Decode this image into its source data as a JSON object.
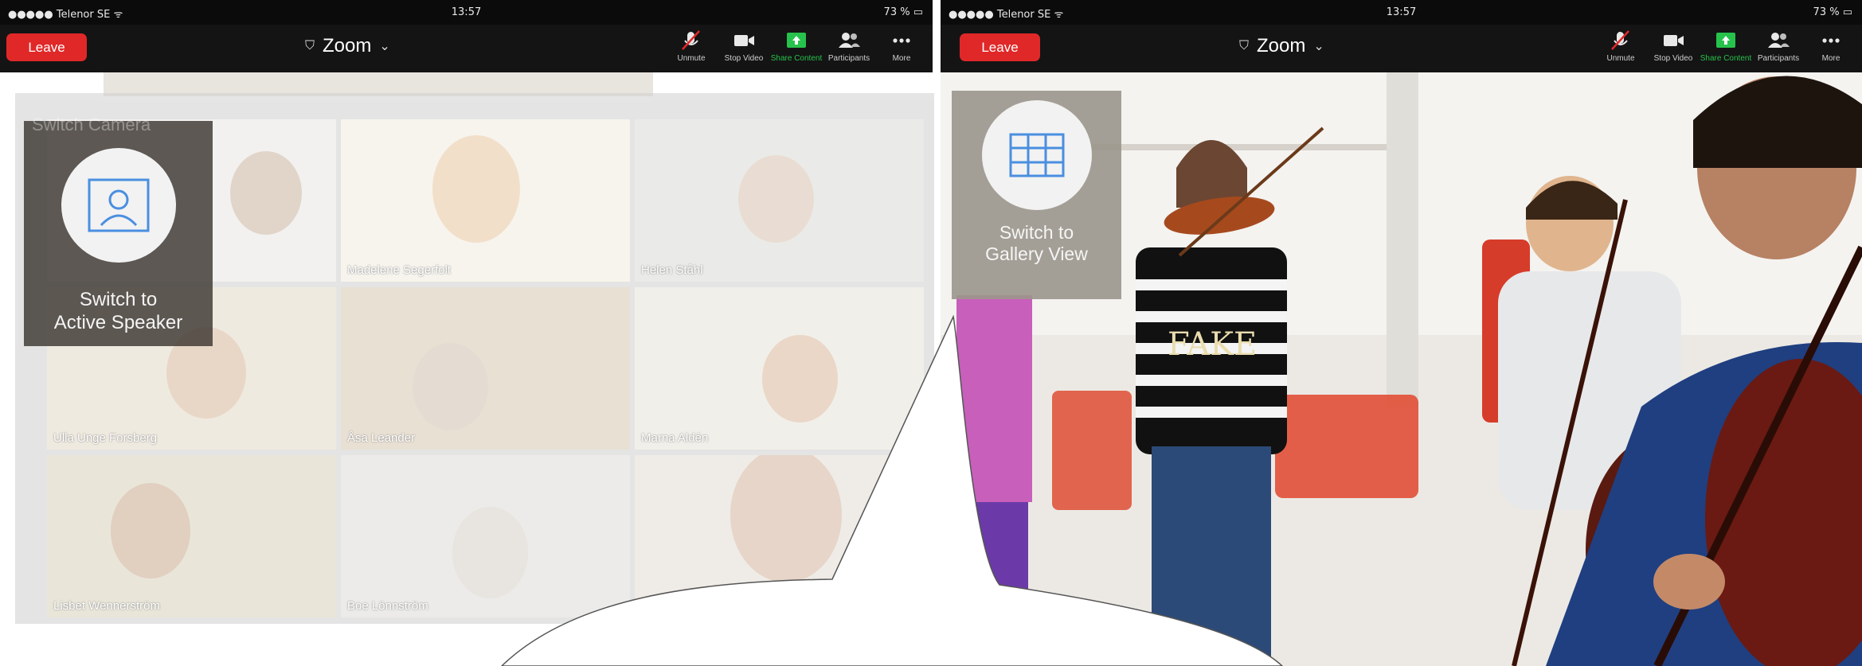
{
  "status_bar": {
    "carrier": "●●●●● Telenor SE ᯤ",
    "time": "13:57",
    "battery": "73 % ▭"
  },
  "toolbar": {
    "leave_label": "Leave",
    "title": "Zoom",
    "unmute": "Unmute",
    "stop_video": "Stop Video",
    "share_content": "Share Content",
    "participants": "Participants",
    "more": "More"
  },
  "left_panel": {
    "switch_caption_line1": "Switch to",
    "switch_caption_line2": "Active Speaker",
    "overlay_top_text": "Switch Camera",
    "participants": [
      "",
      "Madelene Segerfolt",
      "Helen Ståhl",
      "Ulla Unge Forsberg",
      "Åsa Leander",
      "Marna Aldén",
      "Lisbet Wennerström",
      "Boe Lönnström",
      ""
    ]
  },
  "right_panel": {
    "switch_caption_line1": "Switch to",
    "switch_caption_line2": "Gallery View",
    "shirt_text": "FAKE"
  },
  "colors": {
    "leave": "#e02828",
    "share": "#27c24c",
    "icon_blue": "#4a8fe0"
  }
}
